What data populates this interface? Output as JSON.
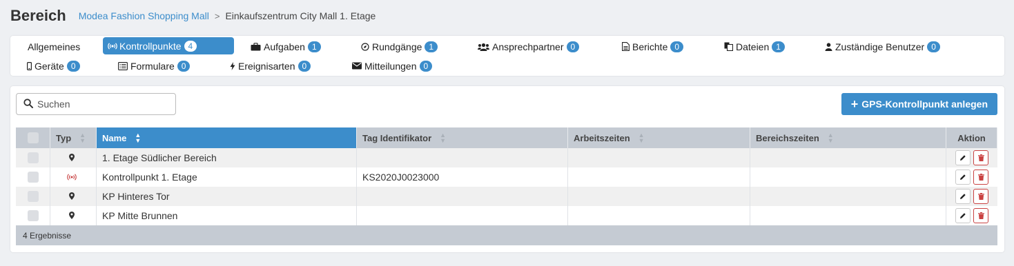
{
  "header": {
    "title": "Bereich",
    "breadcrumb_link": "Modea Fashion Shopping Mall",
    "breadcrumb_separator": ">",
    "breadcrumb_current": "Einkaufszentrum City Mall 1. Etage"
  },
  "tabs": [
    {
      "label": "Allgemeines",
      "icon": "none"
    },
    {
      "label": "Kontrollpunkte",
      "badge": "4",
      "icon": "broadcast-icon",
      "active": true
    },
    {
      "label": "Aufgaben",
      "badge": "1",
      "icon": "briefcase-icon"
    },
    {
      "label": "Rundgänge",
      "badge": "1",
      "icon": "compass-icon"
    },
    {
      "label": "Ansprechpartner",
      "badge": "0",
      "icon": "users-icon"
    },
    {
      "label": "Berichte",
      "badge": "0",
      "icon": "file-icon"
    },
    {
      "label": "Dateien",
      "badge": "1",
      "icon": "files-icon"
    },
    {
      "label": "Zuständige Benutzer",
      "badge": "0",
      "icon": "user-icon"
    },
    {
      "label": "Geräte",
      "badge": "0",
      "icon": "mobile-icon"
    },
    {
      "label": "Formulare",
      "badge": "0",
      "icon": "list-alt-icon"
    },
    {
      "label": "Ereignisarten",
      "badge": "0",
      "icon": "bolt-icon"
    },
    {
      "label": "Mitteilungen",
      "badge": "0",
      "icon": "envelope-icon"
    }
  ],
  "search": {
    "placeholder": "Suchen",
    "value": ""
  },
  "add_button": {
    "label": "GPS-Kontrollpunkt anlegen"
  },
  "table": {
    "columns": [
      "Typ",
      "Name",
      "Tag Identifikator",
      "Arbeitszeiten",
      "Bereichszeiten",
      "Aktion"
    ],
    "sorted_column": "Name",
    "rows": [
      {
        "type": "map-marker-icon",
        "name": "1. Etage Südlicher Bereich",
        "tag": "",
        "arbeitszeiten": "",
        "bereichszeiten": ""
      },
      {
        "type": "broadcast-icon",
        "name": "Kontrollpunkt 1. Etage",
        "tag": "KS2020J0023000",
        "arbeitszeiten": "",
        "bereichszeiten": ""
      },
      {
        "type": "map-marker-icon",
        "name": "KP Hinteres Tor",
        "tag": "",
        "arbeitszeiten": "",
        "bereichszeiten": ""
      },
      {
        "type": "map-marker-icon",
        "name": "KP Mitte Brunnen",
        "tag": "",
        "arbeitszeiten": "",
        "bereichszeiten": ""
      }
    ],
    "footer": "4 Ergebnisse"
  },
  "colors": {
    "accent": "#3c8dcb",
    "danger": "#c94141",
    "header_bg": "#c5cbd3"
  }
}
